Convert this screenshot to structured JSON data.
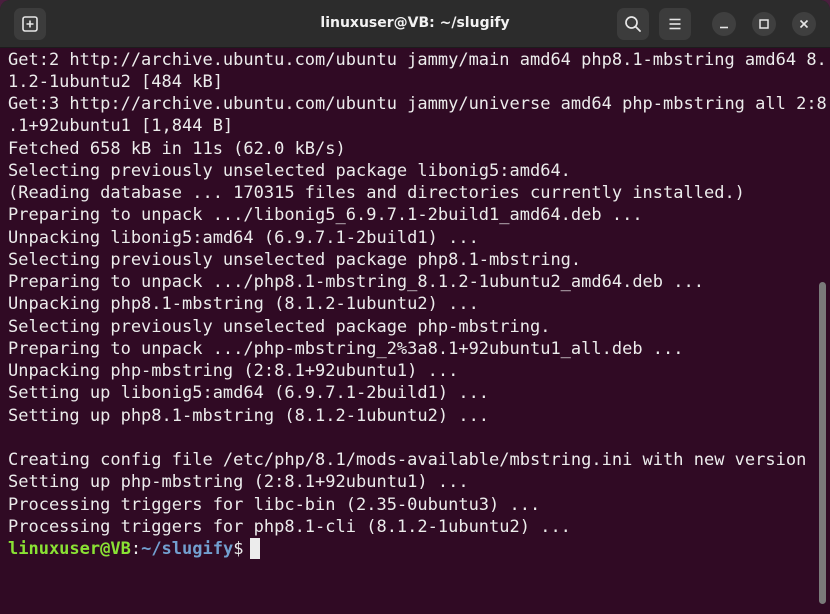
{
  "window": {
    "title": "linuxuser@VB: ~/slugify"
  },
  "toolbar": {
    "new_tab_icon": "new-tab-icon",
    "search_icon": "search-icon",
    "menu_icon": "hamburger-menu-icon",
    "minimize_icon": "minimize-icon",
    "maximize_icon": "maximize-icon",
    "close_icon": "close-icon"
  },
  "terminal": {
    "lines": [
      "Get:2 http://archive.ubuntu.com/ubuntu jammy/main amd64 php8.1-mbstring amd64 8.",
      "1.2-1ubuntu2 [484 kB]",
      "Get:3 http://archive.ubuntu.com/ubuntu jammy/universe amd64 php-mbstring all 2:8",
      ".1+92ubuntu1 [1,844 B]",
      "Fetched 658 kB in 11s (62.0 kB/s)",
      "Selecting previously unselected package libonig5:amd64.",
      "(Reading database ... 170315 files and directories currently installed.)",
      "Preparing to unpack .../libonig5_6.9.7.1-2build1_amd64.deb ...",
      "Unpacking libonig5:amd64 (6.9.7.1-2build1) ...",
      "Selecting previously unselected package php8.1-mbstring.",
      "Preparing to unpack .../php8.1-mbstring_8.1.2-1ubuntu2_amd64.deb ...",
      "Unpacking php8.1-mbstring (8.1.2-1ubuntu2) ...",
      "Selecting previously unselected package php-mbstring.",
      "Preparing to unpack .../php-mbstring_2%3a8.1+92ubuntu1_all.deb ...",
      "Unpacking php-mbstring (2:8.1+92ubuntu1) ...",
      "Setting up libonig5:amd64 (6.9.7.1-2build1) ...",
      "Setting up php8.1-mbstring (8.1.2-1ubuntu2) ...",
      "",
      "Creating config file /etc/php/8.1/mods-available/mbstring.ini with new version",
      "Setting up php-mbstring (2:8.1+92ubuntu1) ...",
      "Processing triggers for libc-bin (2.35-0ubuntu3) ...",
      "Processing triggers for php8.1-cli (8.1.2-1ubuntu2) ..."
    ],
    "prompt": {
      "user_host": "linuxuser@VB",
      "separator": ":",
      "path": "~/slugify",
      "sign": "$"
    }
  },
  "colors": {
    "terminal_bg": "#300a24",
    "text": "#ececec",
    "prompt_user": "#8ae234",
    "prompt_path": "#729fcf",
    "titlebar_bg": "#2c2c2c"
  }
}
